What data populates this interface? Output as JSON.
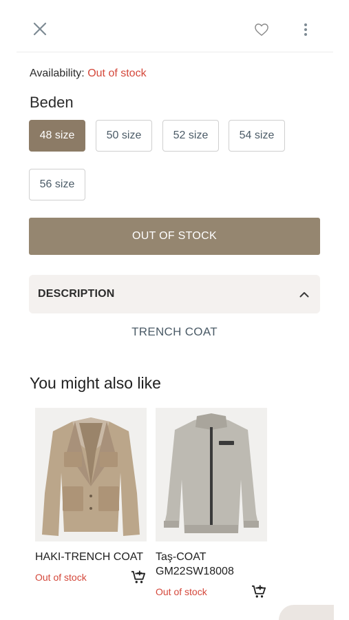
{
  "header": {
    "close_icon": "close-icon",
    "favorite_icon": "heart-outline-icon",
    "more_icon": "more-vertical-icon"
  },
  "availability": {
    "label": "Availability:",
    "status": "Out of stock",
    "status_color": "#d4473a"
  },
  "size_section": {
    "title": "Beden",
    "sizes": [
      "48 size",
      "50 size",
      "52 size",
      "54 size",
      "56 size"
    ],
    "selected": "48 size",
    "selected_color": "#8c7b66"
  },
  "action_button": {
    "label": "OUT OF STOCK",
    "color": "#958670"
  },
  "description": {
    "header": "DESCRIPTION",
    "text": "TRENCH COAT",
    "expanded": true
  },
  "recommendations": {
    "title": "You might also like",
    "items": [
      {
        "name": "HAKI-TRENCH COAT",
        "stock": "Out of stock",
        "image": "beige-blazer"
      },
      {
        "name": "Taş-COAT GM22SW18008",
        "stock": "Out of stock",
        "image": "grey-zip-jacket"
      }
    ]
  }
}
